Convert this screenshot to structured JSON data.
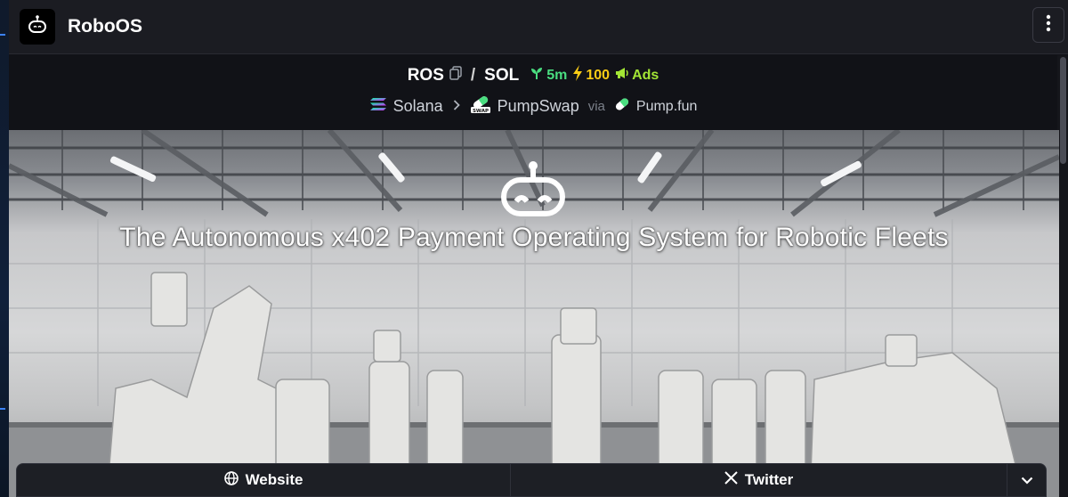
{
  "header": {
    "title": "RoboOS",
    "logo_icon": "robot-head-icon",
    "menu_icon": "vertical-dots-icon"
  },
  "token": {
    "symbol": "ROS",
    "copy_icon": "copy-icon",
    "separator": "/",
    "quote": "SOL",
    "age": "5m",
    "age_icon": "seedling-icon",
    "boost": "100",
    "boost_icon": "lightning-icon",
    "ads": "Ads",
    "ads_icon": "megaphone-icon",
    "chain": "Solana",
    "chain_icon": "solana-icon",
    "dex": "PumpSwap",
    "dex_icon": "pumpswap-icon",
    "via": "via",
    "launchpad": "Pump.fun",
    "launchpad_icon": "pill-icon"
  },
  "banner": {
    "title": "The Autonomous x402 Payment Operating System for Robotic Fleets",
    "icon": "robot-head-icon"
  },
  "links": {
    "website": "Website",
    "website_icon": "globe-icon",
    "twitter": "Twitter",
    "twitter_icon": "x-logo-icon",
    "more_icon": "chevron-down-icon"
  },
  "colors": {
    "age": "#4ade80",
    "boost": "#facc15",
    "ads": "#a3e635",
    "background": "#111217"
  }
}
